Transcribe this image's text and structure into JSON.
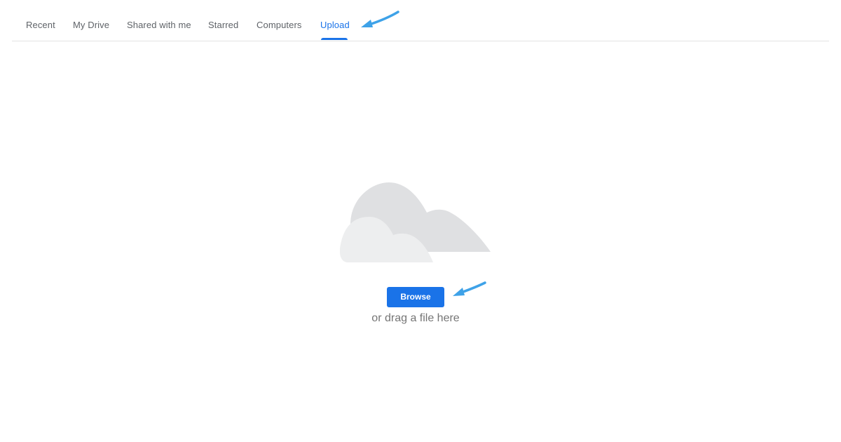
{
  "tabs": [
    {
      "label": "Recent",
      "active": false
    },
    {
      "label": "My Drive",
      "active": false
    },
    {
      "label": "Shared with me",
      "active": false
    },
    {
      "label": "Starred",
      "active": false
    },
    {
      "label": "Computers",
      "active": false
    },
    {
      "label": "Upload",
      "active": true
    }
  ],
  "upload": {
    "illustration_icon": "cloud-icon",
    "browse_label": "Browse",
    "drag_hint": "or drag a file here"
  },
  "annotations": {
    "arrow_icon": "arrow-icon",
    "arrow_color": "#3ea2e8"
  },
  "colors": {
    "accent": "#1a73e8",
    "tab_text": "#5f6368",
    "divider": "#e3e3e3",
    "cloud_back": "#dfe0e2",
    "cloud_front": "#edeeef"
  }
}
